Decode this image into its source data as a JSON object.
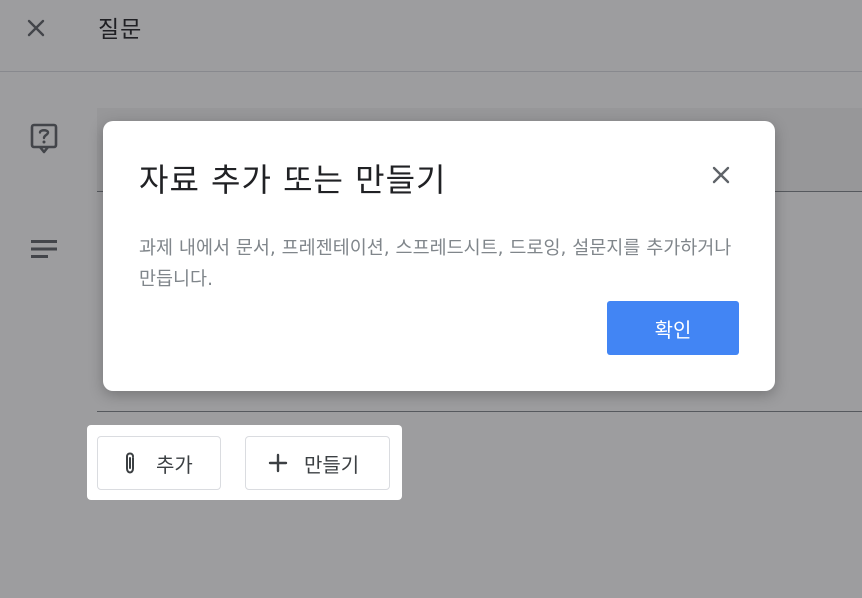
{
  "header": {
    "title": "질문",
    "close_icon": "close-icon"
  },
  "form": {
    "question_icon": "help-outline-icon",
    "description_icon": "notes-icon"
  },
  "attachments": {
    "add_label": "추가",
    "add_icon": "paperclip-icon",
    "create_label": "만들기",
    "create_icon": "plus-icon"
  },
  "dialog": {
    "title": "자료 추가 또는 만들기",
    "body": "과제 내에서 문서, 프레젠테이션, 스프레드시트, 드로잉, 설문지를 추가하거나 만듭니다.",
    "confirm_label": "확인",
    "close_icon": "close-icon"
  },
  "colors": {
    "primary": "#4285f4",
    "text": "#202124",
    "muted_text": "#80868b",
    "scrim": "rgba(32,33,36,0.44)"
  }
}
